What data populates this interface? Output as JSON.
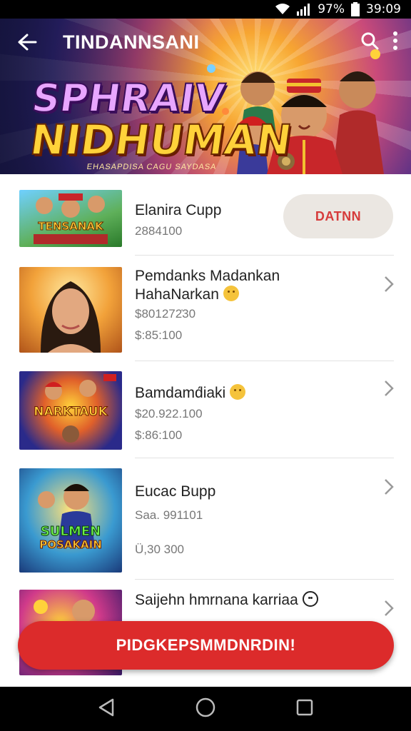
{
  "status_bar": {
    "battery": "97%",
    "time": "39:09"
  },
  "header": {
    "title": "TINDANNSANI"
  },
  "hero": {
    "logo_line1": "SPHRAIV",
    "logo_line2": "NIDHUMAN",
    "logo_sub": "EHASAPDISA CAGU SAYDASA"
  },
  "items": [
    {
      "title": "Elanira Cupp",
      "sub1": "2884100",
      "action": "DATNN",
      "thumb_text": "TENSANAK"
    },
    {
      "title": "Pemdanks Madankan",
      "title2": "HahaNarkan",
      "sub1": "$801272̇30",
      "sub2": "$:85:100",
      "emoji": "smiley"
    },
    {
      "title": "Bamdamd́iaki",
      "sub1": "$20.922.100",
      "sub2": "$:86:100",
      "emoji": "smiley",
      "thumb_text": "NARKTAUK"
    },
    {
      "title": "Eucac Bupp",
      "sub1": "Saa. 991101",
      "sub2": "Ü,30 300",
      "thumb_text1": "SULMEN",
      "thumb_text2": "POSAKAIN"
    },
    {
      "title": "Saijehn hmrnana  karriaa",
      "emoji": "outline"
    }
  ],
  "cta": {
    "label": "PIDGKEPSMMDNRDIN!"
  },
  "colors": {
    "accent": "#dc2b2b",
    "action_text": "#d63b3b",
    "action_bg": "#ebe7e2"
  },
  "icons": [
    "back-arrow-icon",
    "search-icon",
    "more-vert-icon",
    "wifi-icon",
    "signal-icon",
    "battery-icon",
    "chevron-right-icon",
    "nav-back-icon",
    "nav-home-icon",
    "nav-recents-icon"
  ]
}
